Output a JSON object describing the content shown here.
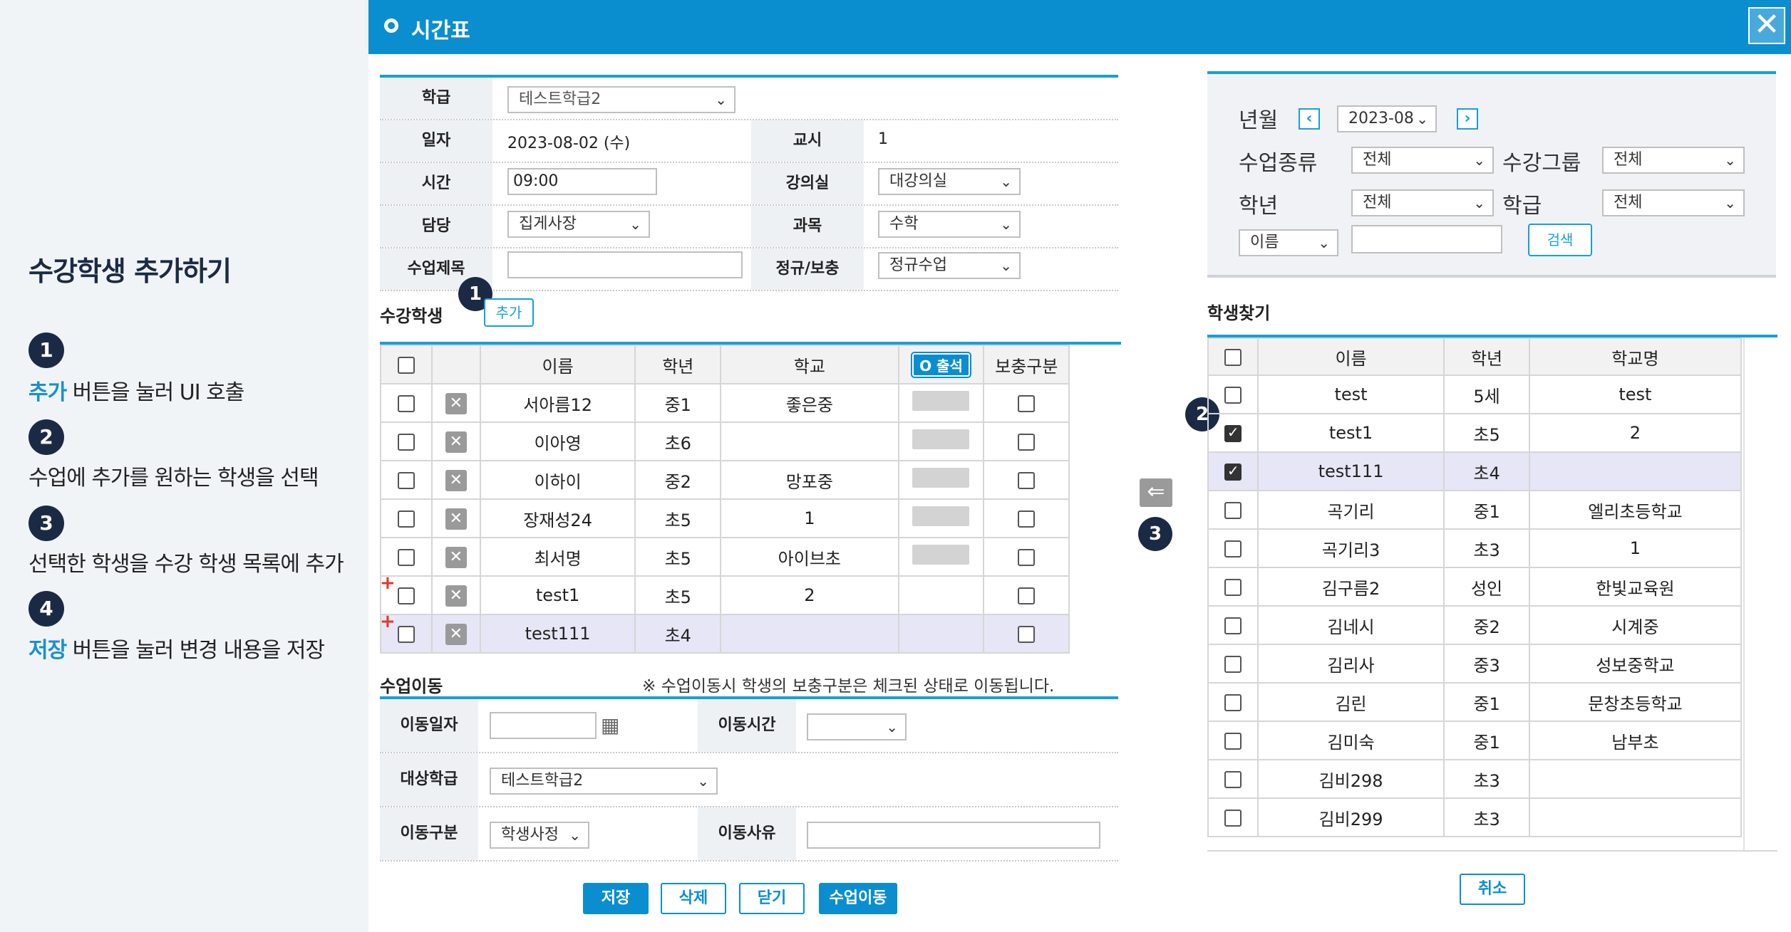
{
  "guide": {
    "title": "수강학생 추가하기",
    "steps": [
      {
        "num": "1",
        "highlight": "추가",
        "text": " 버튼을 눌러 UI 호출"
      },
      {
        "num": "2",
        "highlight": "",
        "text": "수업에 추가를 원하는 학생을 선택"
      },
      {
        "num": "3",
        "highlight": "",
        "text": "선택한 학생을 수강 학생 목록에 추가"
      },
      {
        "num": "4",
        "highlight": "저장",
        "text": " 버튼을 눌러 변경 내용을 저장"
      }
    ]
  },
  "dialog": {
    "title": "시간표",
    "close_icon": "close-icon"
  },
  "form": {
    "class_label": "학급",
    "class_value": "테스트학급2",
    "date_label": "일자",
    "date_value": "2023-08-02 (수)",
    "period_label": "교시",
    "period_value": "1",
    "time_label": "시간",
    "time_value": "09:00",
    "room_label": "강의실",
    "room_value": "대강의실",
    "teacher_label": "담당",
    "teacher_value": "집게사장",
    "subject_label": "과목",
    "subject_value": "수학",
    "lesson_title_label": "수업제목",
    "lesson_title_value": "",
    "regular_label": "정규/보충",
    "regular_value": "정규수업"
  },
  "students": {
    "section_title": "수강학생",
    "add_button": "추가",
    "headers": {
      "name": "이름",
      "grade": "학년",
      "school": "학교",
      "attendance": "O 출석",
      "supplement": "보충구분"
    },
    "rows": [
      {
        "name": "서아름12",
        "grade": "중1",
        "school": "좋은중",
        "added": false
      },
      {
        "name": "이아영",
        "grade": "초6",
        "school": "",
        "added": false
      },
      {
        "name": "이하이",
        "grade": "중2",
        "school": "망포중",
        "added": false
      },
      {
        "name": "장재성24",
        "grade": "초5",
        "school": "1",
        "added": false
      },
      {
        "name": "최서명",
        "grade": "초5",
        "school": "아이브초",
        "added": false
      },
      {
        "name": "test1",
        "grade": "초5",
        "school": "2",
        "added": true
      },
      {
        "name": "test111",
        "grade": "초4",
        "school": "",
        "added": true
      }
    ]
  },
  "move": {
    "section_title": "수업이동",
    "notice": "※ 수업이동시 학생의 보충구분은 체크된 상태로 이동됩니다.",
    "move_date_label": "이동일자",
    "move_date_value": "",
    "move_time_label": "이동시간",
    "move_time_value": "",
    "target_class_label": "대상학급",
    "target_class_value": "테스트학급2",
    "move_type_label": "이동구분",
    "move_type_value": "학생사정",
    "move_reason_label": "이동사유",
    "move_reason_value": ""
  },
  "buttons": {
    "save": "저장",
    "delete": "삭제",
    "close": "닫기",
    "move": "수업이동"
  },
  "search": {
    "year_month_label": "년월",
    "year_month_value": "2023-08",
    "lesson_type_label": "수업종류",
    "lesson_type_value": "전체",
    "group_label": "수강그룹",
    "group_value": "전체",
    "grade_label": "학년",
    "grade_value": "전체",
    "class_label": "학급",
    "class_value": "전체",
    "field_value": "이름",
    "keyword_value": "",
    "search_button": "검색"
  },
  "finder": {
    "section_title": "학생찾기",
    "headers": {
      "name": "이름",
      "grade": "학년",
      "school": "학교명"
    },
    "rows": [
      {
        "name": "test",
        "grade": "5세",
        "school": "test",
        "checked": false,
        "highlight": false
      },
      {
        "name": "test1",
        "grade": "초5",
        "school": "2",
        "checked": true,
        "highlight": false
      },
      {
        "name": "test111",
        "grade": "초4",
        "school": "",
        "checked": true,
        "highlight": true
      },
      {
        "name": "곡기리",
        "grade": "중1",
        "school": "엘리초등학교",
        "checked": false,
        "highlight": false
      },
      {
        "name": "곡기리3",
        "grade": "초3",
        "school": "1",
        "checked": false,
        "highlight": false
      },
      {
        "name": "김구름2",
        "grade": "성인",
        "school": "한빛교육원",
        "checked": false,
        "highlight": false
      },
      {
        "name": "김네시",
        "grade": "중2",
        "school": "시계중",
        "checked": false,
        "highlight": false
      },
      {
        "name": "김리사",
        "grade": "중3",
        "school": "성보중학교",
        "checked": false,
        "highlight": false
      },
      {
        "name": "김린",
        "grade": "중1",
        "school": "문창초등학교",
        "checked": false,
        "highlight": false
      },
      {
        "name": "김미숙",
        "grade": "중1",
        "school": "남부초",
        "checked": false,
        "highlight": false
      },
      {
        "name": "김비298",
        "grade": "초3",
        "school": "",
        "checked": false,
        "highlight": false
      },
      {
        "name": "김비299",
        "grade": "초3",
        "school": "",
        "checked": false,
        "highlight": false
      }
    ],
    "cancel_button": "취소"
  },
  "callouts": {
    "one": "1",
    "two": "2",
    "three": "3"
  }
}
